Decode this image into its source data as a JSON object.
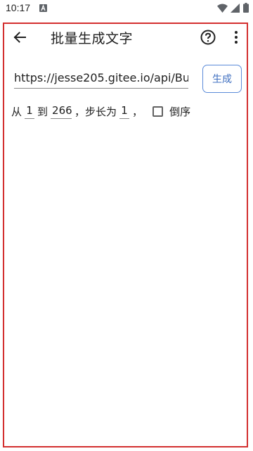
{
  "status_bar": {
    "time": "10:17",
    "notification_icon": "a-notification-icon",
    "wifi_icon": "wifi-icon",
    "signal_icon": "signal-icon",
    "battery_icon": "battery-icon"
  },
  "toolbar": {
    "title": "批量生成文字",
    "back_icon": "back-arrow-icon",
    "help_icon": "help-circle-icon",
    "more_icon": "more-vertical-icon"
  },
  "form": {
    "url_value": "https://jesse205.gitee.io/api/Bu",
    "generate_label": "生成",
    "from_label": "从",
    "from_value": "1",
    "to_label": "到",
    "to_value": "266",
    "step_label": "，步长为",
    "step_value": "1",
    "comma": "，",
    "reverse_label": "倒序",
    "reverse_checked": false
  },
  "colors": {
    "frame_border": "#d32f2f",
    "button_accent": "#3f6fc0"
  }
}
